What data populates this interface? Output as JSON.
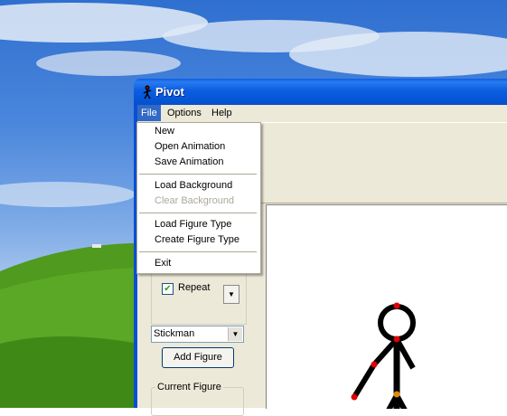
{
  "window": {
    "title": "Pivot"
  },
  "menubar": {
    "items": [
      "File",
      "Options",
      "Help"
    ]
  },
  "file_menu": {
    "group1": [
      "New",
      "Open Animation",
      "Save Animation"
    ],
    "group2": [
      "Load Background",
      "Clear Background"
    ],
    "group3": [
      "Load Figure Type",
      "Create Figure Type"
    ],
    "group4": [
      "Exit"
    ]
  },
  "controls": {
    "repeat_label": "Repeat",
    "repeat_checked": true,
    "figure_select": "Stickman",
    "add_figure_label": "Add Figure",
    "current_figure_label": "Current Figure"
  },
  "colors": {
    "menu_highlight": "#316ac5",
    "title_bar": "#0454d6",
    "joint_red": "#e00000",
    "joint_orange": "#e08a00"
  }
}
